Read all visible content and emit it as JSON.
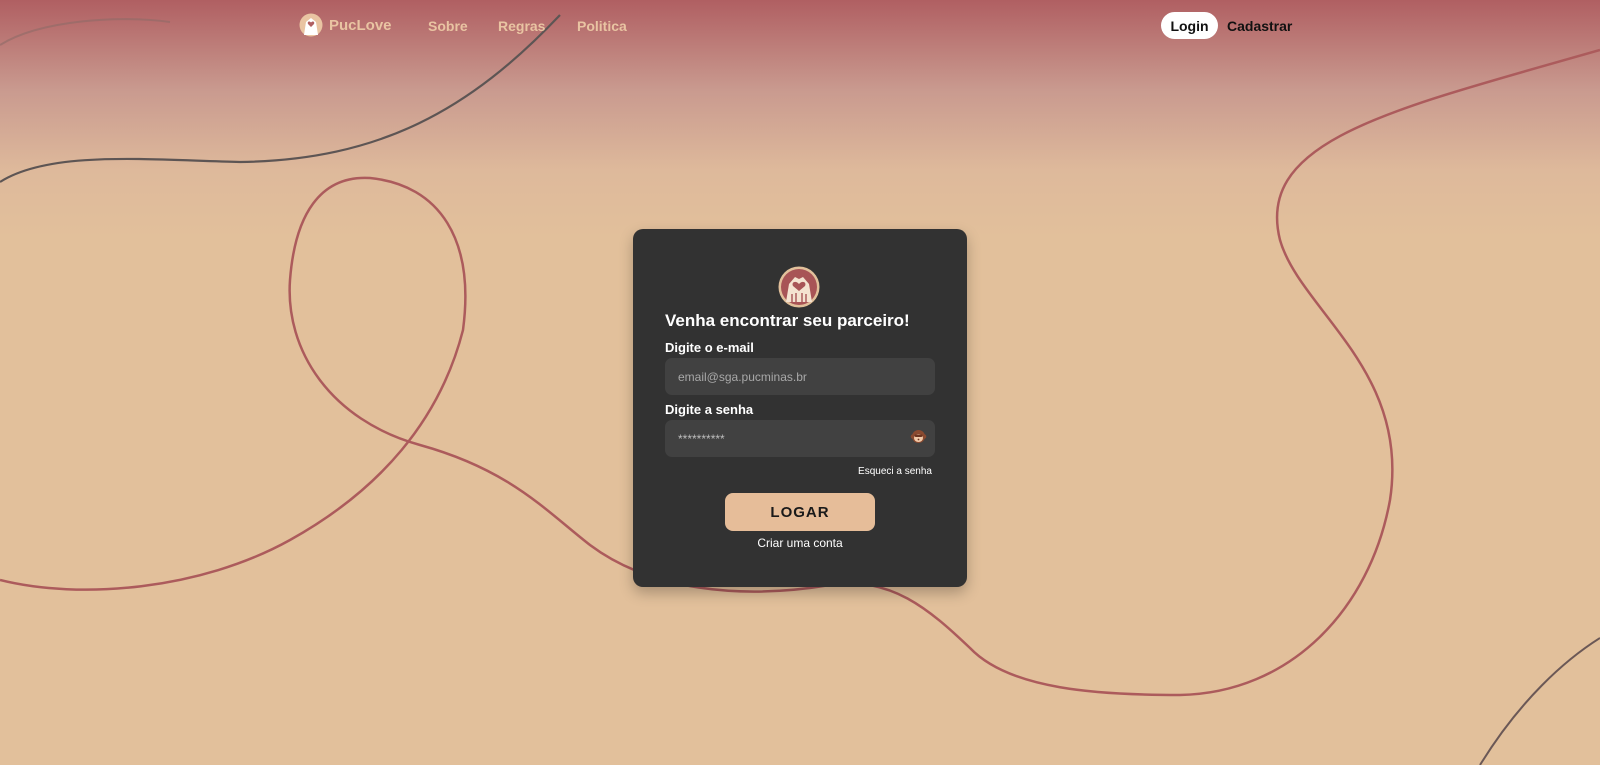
{
  "colors": {
    "accent": "#e6bd99",
    "card_bg": "#323232",
    "input_bg": "#414141",
    "curve": "#ac5b5c"
  },
  "nav": {
    "brand": "PucLove",
    "links": [
      "Sobre",
      "Regras",
      "Politica"
    ],
    "login": "Login",
    "signup": "Cadastrar"
  },
  "card": {
    "title": "Venha encontrar seu parceiro!",
    "email_label": "Digite o e-mail",
    "email_placeholder": "email@sga.pucminas.br",
    "password_label": "Digite a senha",
    "password_value": "**********",
    "forgot": "Esqueci a senha",
    "submit": "LOGAR",
    "create": "Criar uma conta"
  }
}
